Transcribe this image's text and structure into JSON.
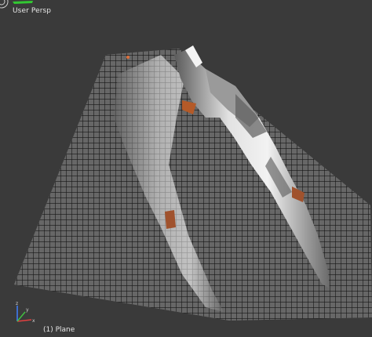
{
  "viewport": {
    "view_name": "User Persp",
    "active_object": "(1) Plane"
  },
  "gizmo": {
    "axes": [
      "x",
      "y",
      "z"
    ],
    "axis_colors": {
      "x": "#e04040",
      "y": "#40c040",
      "z": "#4080ff"
    }
  },
  "scene": {
    "background_color": "#3a3a3a",
    "grid_color": "#1a1a1a",
    "plane_color": "#8e8e8e",
    "model_light_color": "#d8d8d8",
    "model_dark_color": "#4a4a4a",
    "accent_color": "#b0562a"
  },
  "indicators": {
    "top_bar_color": "#32c832"
  }
}
